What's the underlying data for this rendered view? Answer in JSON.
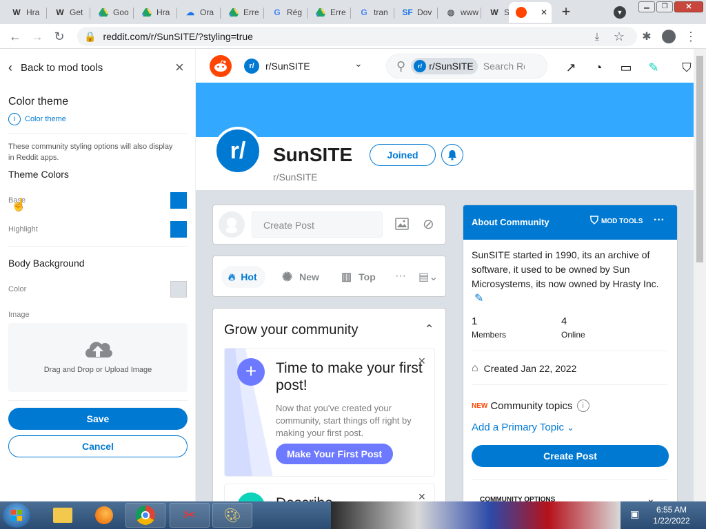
{
  "browser": {
    "tabs": [
      {
        "label": "Hra",
        "icon": "W",
        "color": "#333333"
      },
      {
        "label": "Get",
        "icon": "W",
        "color": "#333333"
      },
      {
        "label": "Goo",
        "icon": "drive",
        "color": "#1fa463"
      },
      {
        "label": "Hra",
        "icon": "drive",
        "color": "#1fa463"
      },
      {
        "label": "Ora",
        "icon": "cloud",
        "color": "#1a73e8"
      },
      {
        "label": "Erre",
        "icon": "drive",
        "color": "#1fa463"
      },
      {
        "label": "Rég",
        "icon": "G",
        "color": "#4285f4"
      },
      {
        "label": "Erre",
        "icon": "drive",
        "color": "#1fa463"
      },
      {
        "label": "tran",
        "icon": "G",
        "color": "#4285f4"
      },
      {
        "label": "Dov",
        "icon": "SF",
        "color": "#1a73e8"
      },
      {
        "label": "www",
        "icon": "globe",
        "color": "#5f6368"
      },
      {
        "label": "Sun",
        "icon": "W",
        "color": "#333333"
      },
      {
        "label": "",
        "icon": "reddit",
        "color": "#ff4500"
      }
    ],
    "new_tab": "+",
    "url": "reddit.com/r/SunSITE/?styling=true"
  },
  "panel": {
    "back_label": "Back to mod tools",
    "section_title": "Color theme",
    "section_link": "Color theme",
    "note": "These community styling options will also display in Reddit apps.",
    "theme_colors_title": "Theme Colors",
    "base_label": "Base",
    "highlight_label": "Highlight",
    "body_bg_title": "Body Background",
    "color_label": "Color",
    "image_label": "Image",
    "upload_label": "Drag and Drop or Upload Image",
    "save_label": "Save",
    "cancel_label": "Cancel",
    "colors": {
      "base": "#0079d3",
      "highlight": "#0079d3",
      "body": "#dae0e6"
    }
  },
  "header": {
    "community": "r/SunSITE",
    "search_chip": "r/SunSITE",
    "search_placeholder": "Search Re"
  },
  "banner_color": "#33a8ff",
  "community": {
    "name": "SunSITE",
    "sub": "r/SunSITE",
    "joined_label": "Joined"
  },
  "create_post": {
    "placeholder": "Create Post"
  },
  "sort": {
    "hot": "Hot",
    "new": "New",
    "top": "Top",
    "more": "···"
  },
  "grow": {
    "title": "Grow your community",
    "card_title": "Time to make your first post!",
    "card_body": "Now that you've created your community, start things off right by making your first post.",
    "card_button": "Make Your First Post",
    "next_title": "Describe"
  },
  "about": {
    "title": "About Community",
    "mod_tools": "MOD TOOLS",
    "description": "SunSITE started in 1990, its an archive of software, it used to be owned by Sun Microsystems, its now owned by Hrasty Inc.",
    "members_value": "1",
    "members_label": "Members",
    "online_value": "4",
    "online_label": "Online",
    "created": "Created Jan 22, 2022",
    "new_badge": "NEW",
    "topics_label": "Community topics",
    "add_topic": "Add a Primary Topic",
    "create_post": "Create Post",
    "options": "COMMUNITY OPTIONS"
  },
  "taskbar": {
    "time": "6:55 AM",
    "date": "1/22/2022"
  }
}
